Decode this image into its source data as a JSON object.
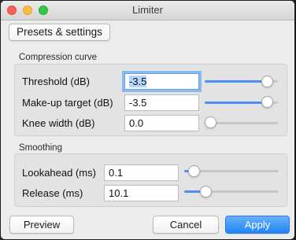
{
  "window": {
    "title": "Limiter"
  },
  "toolbar": {
    "presets_label": "Presets & settings"
  },
  "compression_curve": {
    "title": "Compression curve",
    "threshold": {
      "label": "Threshold (dB)",
      "value": "-3.5",
      "slider_level": 0.96
    },
    "makeup": {
      "label": "Make-up target (dB)",
      "value": "-3.5",
      "slider_level": 0.96
    },
    "knee": {
      "label": "Knee width (dB)",
      "value": "0.0",
      "slider_level": 0.0
    }
  },
  "smoothing": {
    "title": "Smoothing",
    "lookahead": {
      "label": "Lookahead (ms)",
      "value": "0.1",
      "slider_level": 0.08
    },
    "release": {
      "label": "Release (ms)",
      "value": "10.1",
      "slider_level": 0.22
    }
  },
  "footer": {
    "preview_label": "Preview",
    "cancel_label": "Cancel",
    "apply_label": "Apply"
  },
  "colors": {
    "accent": "#1f84f7",
    "slider_fill": "#4b8ff6",
    "close": "#fc605b",
    "minimize": "#fdbc40",
    "maximize": "#34c84a"
  }
}
